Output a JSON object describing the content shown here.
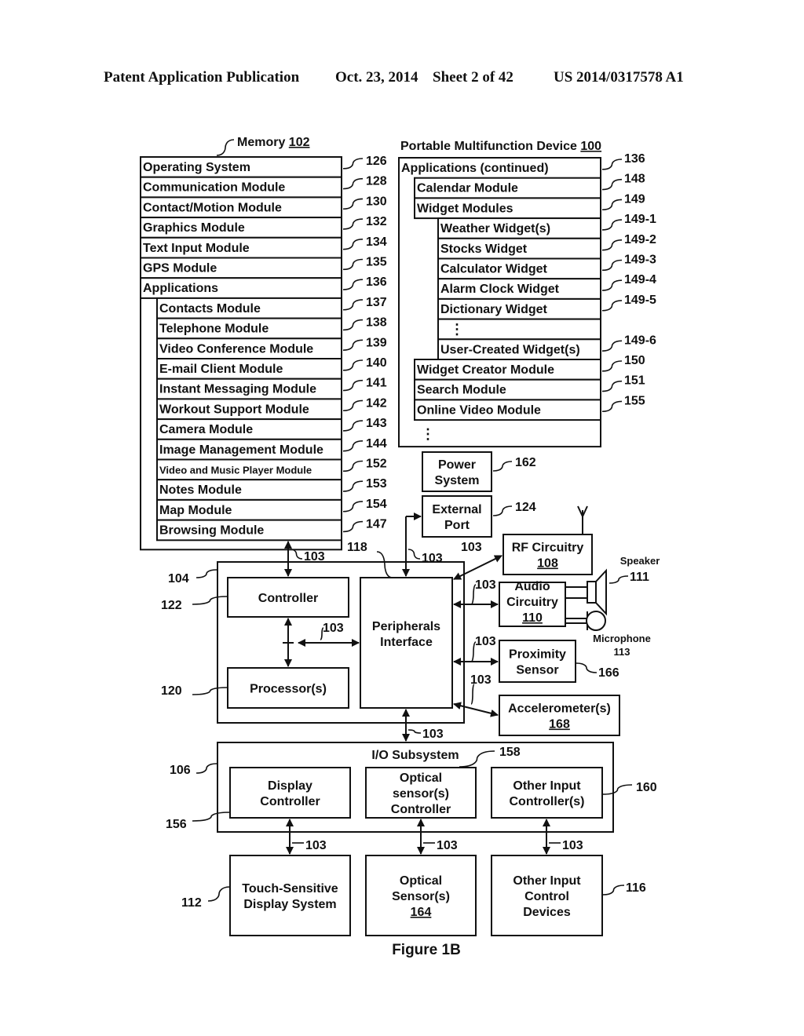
{
  "header": {
    "publication": "Patent Application Publication",
    "date": "Oct. 23, 2014",
    "sheet": "Sheet 2 of 42",
    "number": "US 2014/0317578 A1"
  },
  "memory": {
    "title": "Memory",
    "ref": "102",
    "items": [
      {
        "label": "Operating System",
        "ref": "126",
        "indent": 0
      },
      {
        "label": "Communication Module",
        "ref": "128",
        "indent": 0
      },
      {
        "label": "Contact/Motion Module",
        "ref": "130",
        "indent": 0
      },
      {
        "label": "Graphics Module",
        "ref": "132",
        "indent": 0
      },
      {
        "label": "Text Input Module",
        "ref": "134",
        "indent": 0
      },
      {
        "label": "GPS Module",
        "ref": "135",
        "indent": 0
      },
      {
        "label": "Applications",
        "ref": "136",
        "indent": 0
      },
      {
        "label": "Contacts Module",
        "ref": "137",
        "indent": 1
      },
      {
        "label": "Telephone Module",
        "ref": "138",
        "indent": 1
      },
      {
        "label": "Video Conference Module",
        "ref": "139",
        "indent": 1
      },
      {
        "label": "E-mail Client Module",
        "ref": "140",
        "indent": 1
      },
      {
        "label": "Instant Messaging Module",
        "ref": "141",
        "indent": 1
      },
      {
        "label": "Workout Support Module",
        "ref": "142",
        "indent": 1
      },
      {
        "label": "Camera Module",
        "ref": "143",
        "indent": 1
      },
      {
        "label": "Image Management Module",
        "ref": "144",
        "indent": 1
      },
      {
        "label": "Video and Music Player Module",
        "ref": "152",
        "indent": 1,
        "small": true
      },
      {
        "label": "Notes Module",
        "ref": "153",
        "indent": 1
      },
      {
        "label": "Map Module",
        "ref": "154",
        "indent": 1
      },
      {
        "label": "Browsing Module",
        "ref": "147",
        "indent": 1
      }
    ]
  },
  "device": {
    "title": "Portable Multifunction Device",
    "ref": "100",
    "items": [
      {
        "label": "Applications (continued)",
        "ref": "136",
        "indent": 0
      },
      {
        "label": "Calendar Module",
        "ref": "148",
        "indent": 1
      },
      {
        "label": "Widget Modules",
        "ref": "149",
        "indent": 1
      },
      {
        "label": "Weather Widget(s)",
        "ref": "149-1",
        "indent": 2
      },
      {
        "label": "Stocks Widget",
        "ref": "149-2",
        "indent": 2
      },
      {
        "label": "Calculator Widget",
        "ref": "149-3",
        "indent": 2
      },
      {
        "label": "Alarm Clock Widget",
        "ref": "149-4",
        "indent": 2
      },
      {
        "label": "Dictionary Widget",
        "ref": "149-5",
        "indent": 2
      },
      {
        "label": "⋮",
        "ref": "",
        "indent": 2,
        "ellipsis": true
      },
      {
        "label": "User-Created Widget(s)",
        "ref": "149-6",
        "indent": 2
      },
      {
        "label": "Widget Creator Module",
        "ref": "150",
        "indent": 1
      },
      {
        "label": "Search Module",
        "ref": "151",
        "indent": 1
      },
      {
        "label": "Online Video Module",
        "ref": "155",
        "indent": 1
      }
    ],
    "more": "⋮"
  },
  "blocks": {
    "power": {
      "lines": [
        "Power",
        "System"
      ],
      "ref": "162"
    },
    "external_port": {
      "lines": [
        "External",
        "Port"
      ],
      "ref": "124"
    },
    "rf": {
      "lines": [
        "RF Circuitry"
      ],
      "underline": "108"
    },
    "audio": {
      "lines": [
        "Audio",
        "Circuitry"
      ],
      "underline": "110"
    },
    "proximity": {
      "lines": [
        "Proximity",
        "Sensor"
      ],
      "ref": "166"
    },
    "accelerometer": {
      "lines": [
        "Accelerometer(s)"
      ],
      "underline": "168"
    },
    "controller": {
      "lines": [
        "Controller"
      ],
      "ref": "122"
    },
    "processor": {
      "lines": [
        "Processor(s)"
      ],
      "ref": "120"
    },
    "peripherals": {
      "lines": [
        "Peripherals",
        "Interface"
      ],
      "ref": "118"
    },
    "chip_ref": "104",
    "io": {
      "title": "I/O Subsystem",
      "ref": "106"
    },
    "display_controller": {
      "lines": [
        "Display",
        "Controller"
      ],
      "ref": "156"
    },
    "optical_controller": {
      "lines": [
        "Optical",
        "sensor(s)",
        "Controller"
      ],
      "ref": "158"
    },
    "other_input_controller": {
      "lines": [
        "Other Input",
        "Controller(s)"
      ],
      "ref": "160"
    },
    "touch_display": {
      "lines": [
        "Touch-Sensitive",
        "Display System"
      ],
      "ref": "112"
    },
    "optical_sensor": {
      "lines": [
        "Optical",
        "Sensor(s)"
      ],
      "underline": "164"
    },
    "other_input_devices": {
      "lines": [
        "Other Input",
        "Control",
        "Devices"
      ],
      "ref": "116"
    }
  },
  "speaker": {
    "label": "Speaker",
    "ref": "111"
  },
  "microphone": {
    "label": "Microphone",
    "ref": "113"
  },
  "bus_ref": "103",
  "caption": "Figure 1B"
}
